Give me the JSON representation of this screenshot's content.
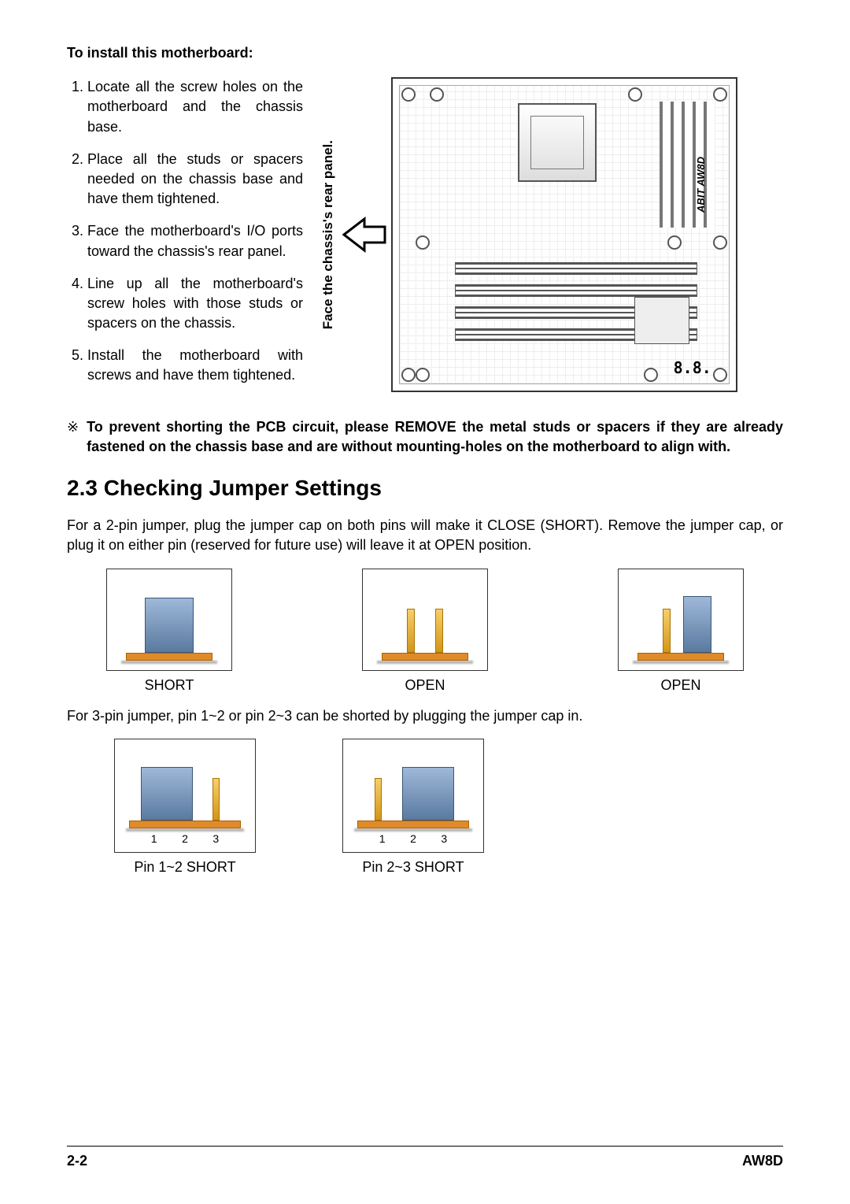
{
  "install_heading": "To install this motherboard:",
  "steps": [
    "Locate all the screw holes on the motherboard and the chassis base.",
    "Place all the studs or spacers needed on the chassis base and have them tightened.",
    "Face the motherboard's I/O ports toward the chassis's rear panel.",
    "Line up all the motherboard's screw holes with those studs or spacers on the chassis.",
    "Install the motherboard with screws and have them tightened."
  ],
  "vertical_label": "Face the chassis's rear panel.",
  "mobo_brand": "ABIT AW8D",
  "seg7": "8.8.",
  "note_symbol": "※",
  "note_text": "To prevent shorting the PCB circuit, please REMOVE the metal studs or spacers if they are already fastened on the chassis base and are without mounting-holes on the motherboard to align with.",
  "section_title": "2.3 Checking Jumper Settings",
  "para_2pin": "For a 2-pin jumper, plug the jumper cap on both pins will make it CLOSE (SHORT). Remove the jumper cap, or plug it on either pin (reserved for future use) will leave it at OPEN position.",
  "labels_2pin": {
    "short": "SHORT",
    "open1": "OPEN",
    "open2": "OPEN"
  },
  "para_3pin": "For 3-pin jumper, pin 1~2 or pin 2~3 can be shorted by plugging the jumper cap in.",
  "pin_nums": {
    "n1": "1",
    "n2": "2",
    "n3": "3"
  },
  "labels_3pin": {
    "left": "Pin 1~2 SHORT",
    "right": "Pin 2~3 SHORT"
  },
  "footer": {
    "page": "2-2",
    "model": "AW8D"
  }
}
